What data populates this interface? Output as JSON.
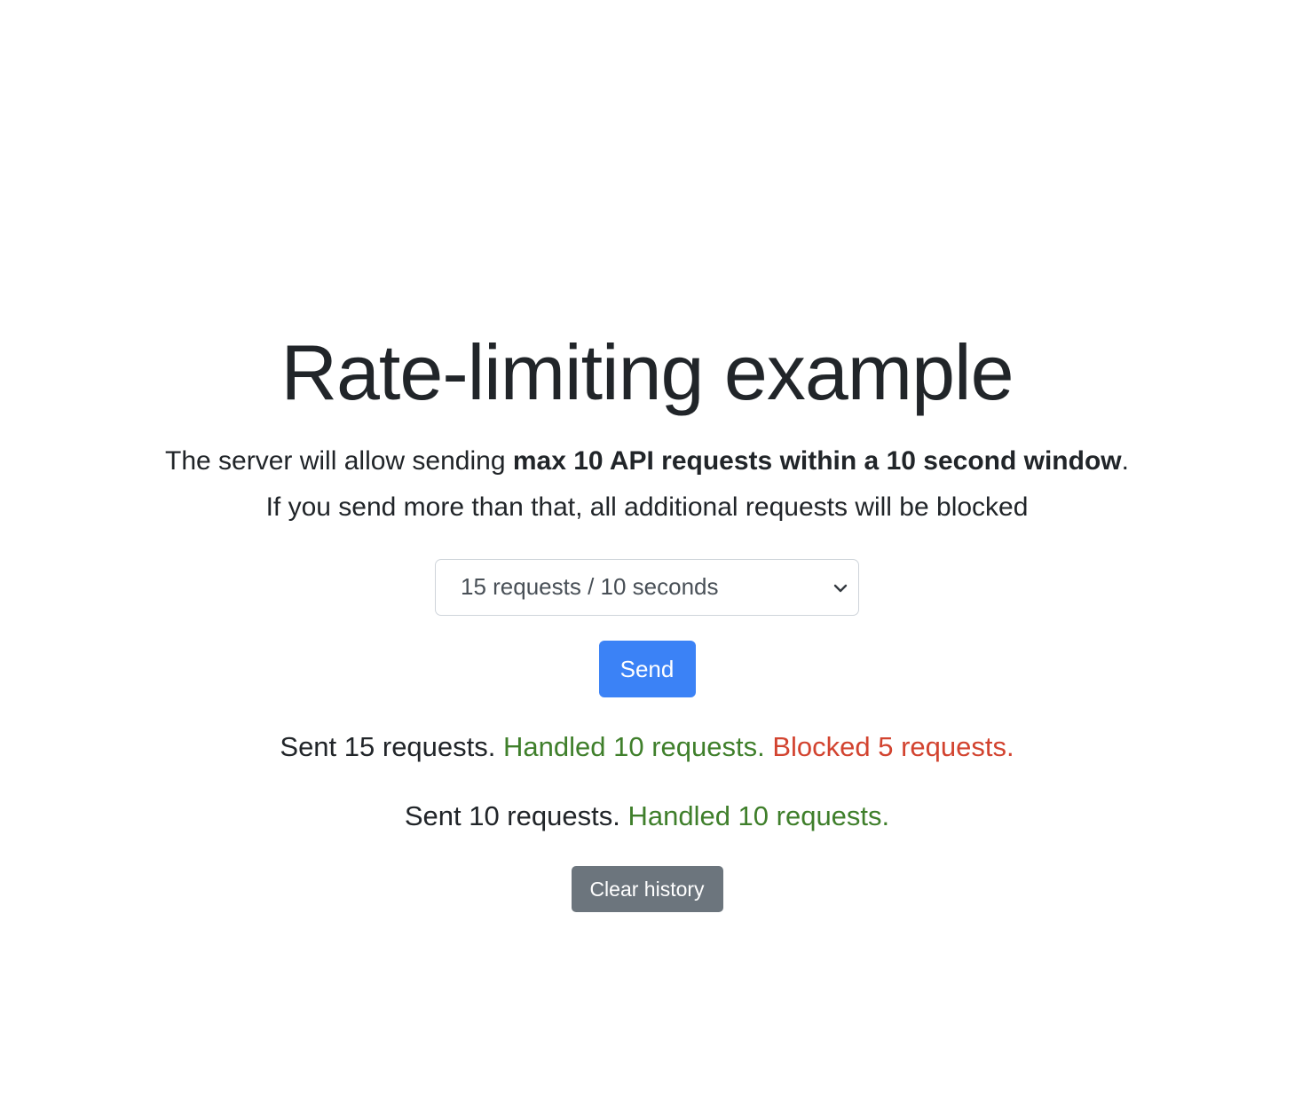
{
  "page": {
    "title": "Rate-limiting example",
    "description": {
      "line1_prefix": "The server will allow sending ",
      "line1_bold": "max 10 API requests within a 10 second window",
      "line1_suffix": ".",
      "line2": "If you send more than that, all additional requests will be blocked"
    }
  },
  "controls": {
    "rate_select": {
      "selected": "15 requests / 10 seconds",
      "icon": "chevron-down-icon"
    },
    "send_label": "Send",
    "clear_label": "Clear history"
  },
  "history": [
    {
      "sent": "Sent 15 requests.",
      "handled": "Handled 10 requests.",
      "blocked": "Blocked 5 requests."
    },
    {
      "sent": "Sent 10 requests.",
      "handled": "Handled 10 requests."
    }
  ],
  "colors": {
    "primary": "#3b82f6",
    "secondary": "#6c757d",
    "success": "#3f7f2b",
    "danger": "#d2432f"
  }
}
